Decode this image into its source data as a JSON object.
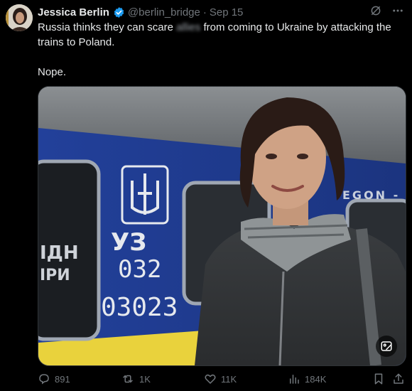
{
  "tweet": {
    "author_name": "Jessica Berlin",
    "handle": "@berlin_bridge",
    "separator": "·",
    "date": "Sep 15",
    "text_before": "Russia thinks they can scare ",
    "text_blurred": "allies",
    "text_after": " from coming to Ukraine by attacking the trains to Poland.",
    "text_second": "Nope."
  },
  "media": {
    "alt": "Selfie of a smiling woman in a scarf and grey jacket in front of a blue Ukrainian train car",
    "train_code_abbr": "УЗ",
    "train_number": "032",
    "car_number": "03023",
    "side_text": "ІДН",
    "side_text_2": "ІРИ",
    "train_brand_text": "EGON -"
  },
  "actions": {
    "replies": "891",
    "reposts": "1K",
    "likes": "11K",
    "views": "184K"
  },
  "colors": {
    "background": "#000000",
    "text": "#e7e9ea",
    "muted": "#71767b",
    "verified": "#1d9bf0",
    "train_blue": "#1f3f9c",
    "train_yellow": "#e9d23c"
  },
  "icons": [
    "verified-badge-icon",
    "grok-icon",
    "more-icon",
    "image-edit-icon",
    "reply-icon",
    "repost-icon",
    "like-icon",
    "views-icon",
    "bookmark-icon",
    "share-icon"
  ]
}
